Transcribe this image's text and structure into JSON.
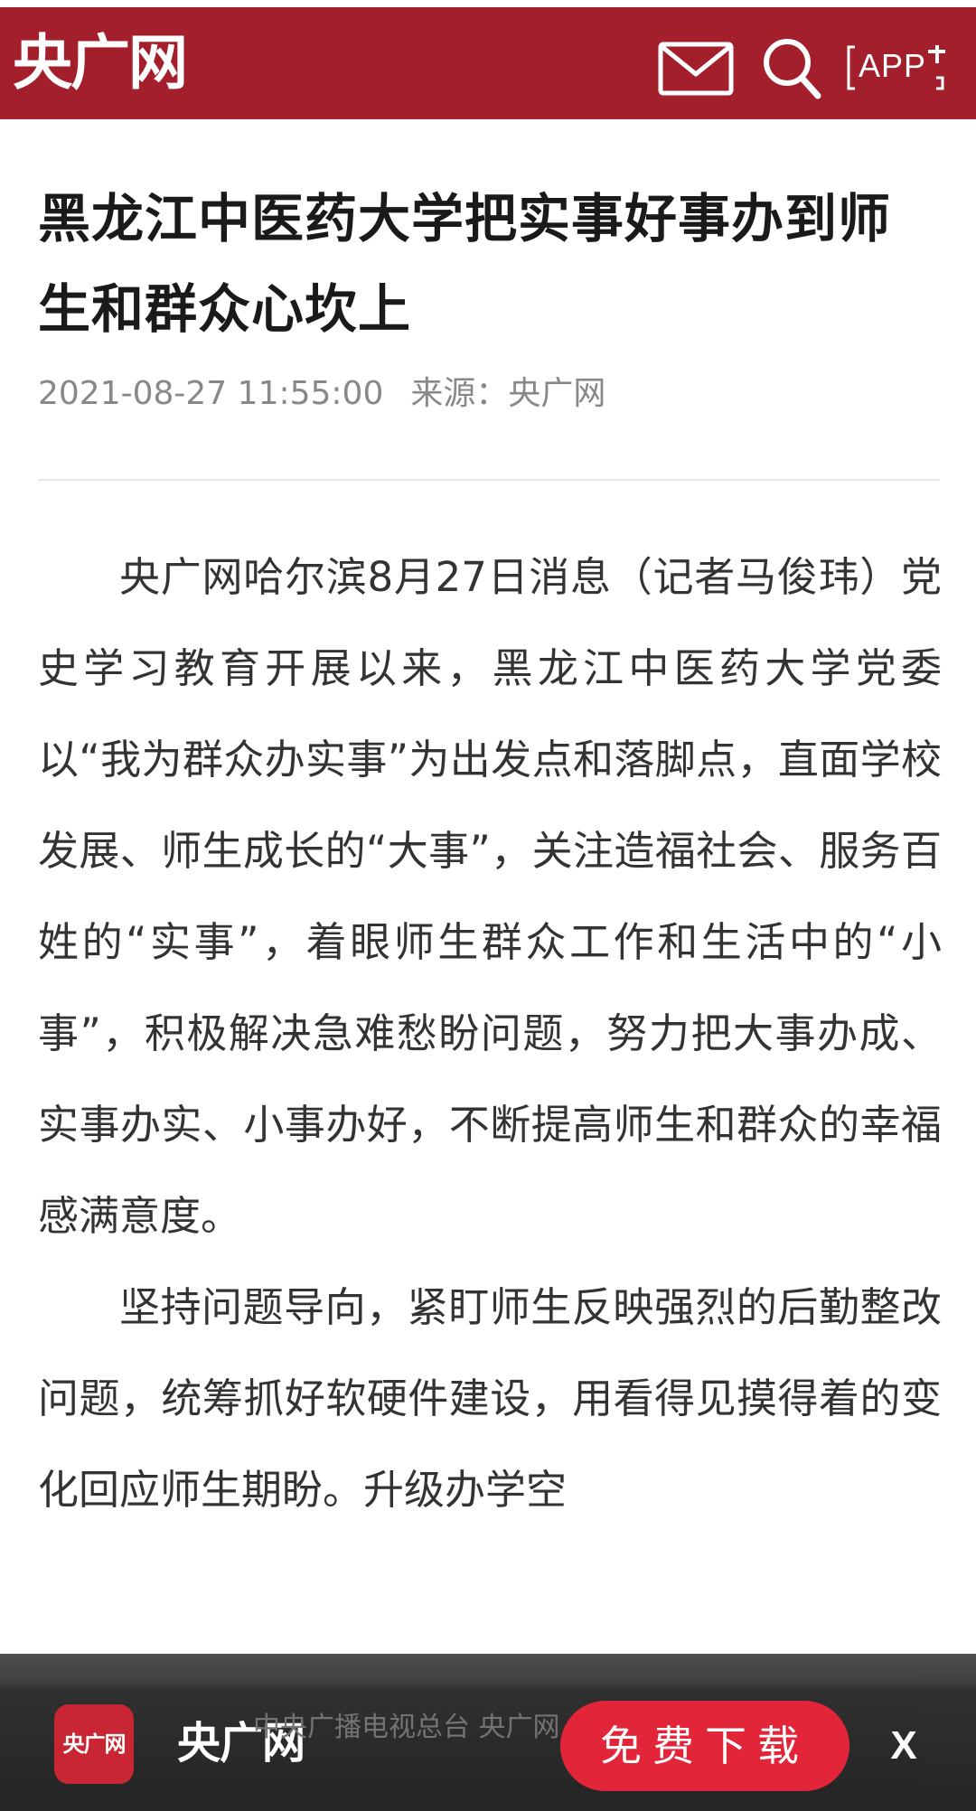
{
  "header": {
    "logo": "央广网",
    "mail_icon": "mail-icon",
    "search_icon": "search-icon",
    "app_label": "APP",
    "background_color": "#a31f2c"
  },
  "article": {
    "title": "黑龙江中医药大学把实事好事办到师生和群众心坎上",
    "datetime": "2021-08-27 11:55:00",
    "source_label": "来源：",
    "source_name": "央广网",
    "paragraphs": [
      "央广网哈尔滨8月27日消息（记者马俊玮）党史学习教育开展以来，黑龙江中医药大学党委以“我为群众办实事”为出发点和落脚点，直面学校发展、师生成长的“大事”，关注造福社会、服务百姓的“实事”，着眼师生群众工作和生活中的“小事”，积极解决急难愁盼问题，努力把大事办成、实事办实、小事办好，不断提高师生和群众的幸福感满意度。",
      "坚持问题导向，紧盯师生反映强烈的后勤整改问题，统筹抓好软硬件建设，用看得见摸得着的变化回应师生期盼。升级办学空"
    ]
  },
  "banner": {
    "app_icon_text": "央广网",
    "logo": "央广网",
    "caption": "中央广播电视总台 央广网",
    "download_label": "免费下载",
    "close_label": "X",
    "button_color": "#e31e33"
  }
}
